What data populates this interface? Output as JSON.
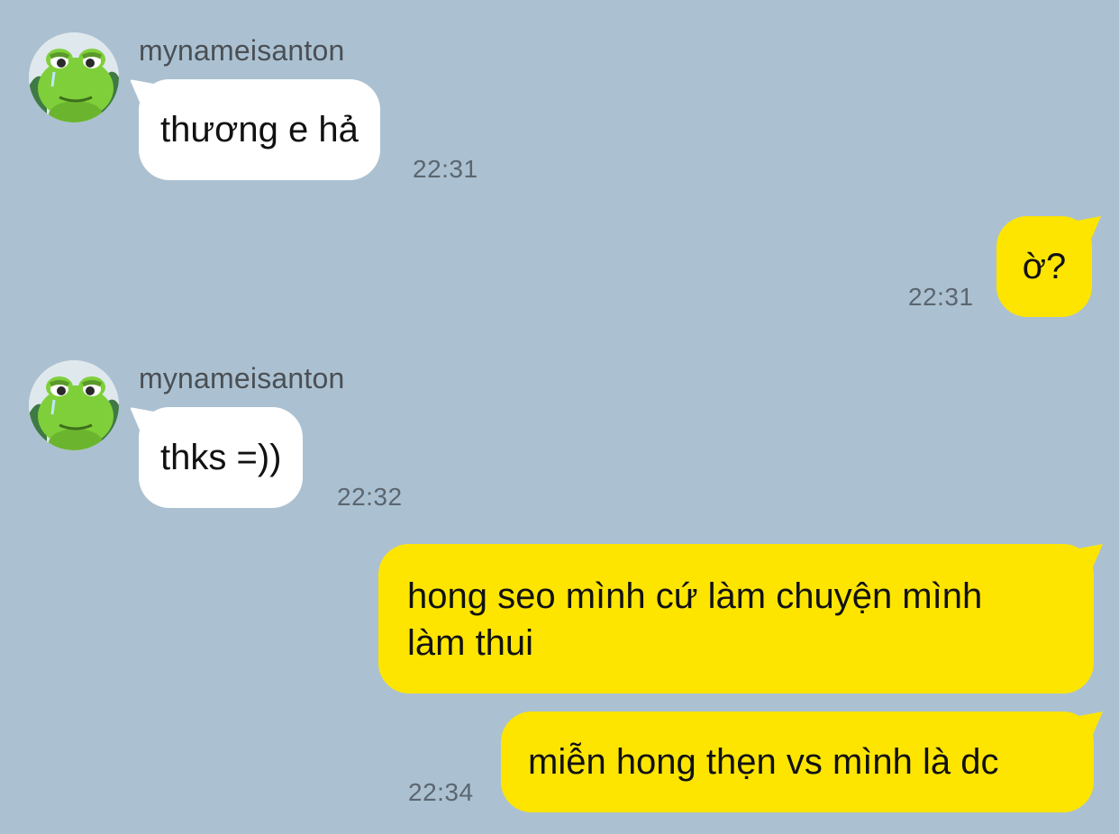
{
  "contact": {
    "name": "mynameisanton",
    "avatar_icon": "frog-avatar-icon"
  },
  "colors": {
    "background": "#abc1d1",
    "incoming_bubble": "#ffffff",
    "outgoing_bubble": "#fee500",
    "timestamp": "#5b6670"
  },
  "messages": [
    {
      "direction": "incoming",
      "sender": "mynameisanton",
      "text": "thương e hả",
      "time": "22:31"
    },
    {
      "direction": "outgoing",
      "text": "ờ?",
      "time": "22:31"
    },
    {
      "direction": "incoming",
      "sender": "mynameisanton",
      "text": "thks =))",
      "time": "22:32"
    },
    {
      "direction": "outgoing",
      "lines": [
        "hong seo mình cứ làm chuyện mình",
        "làm thui"
      ],
      "time": ""
    },
    {
      "direction": "outgoing",
      "text": "miễn hong thẹn vs mình là dc",
      "time": "22:34"
    }
  ]
}
